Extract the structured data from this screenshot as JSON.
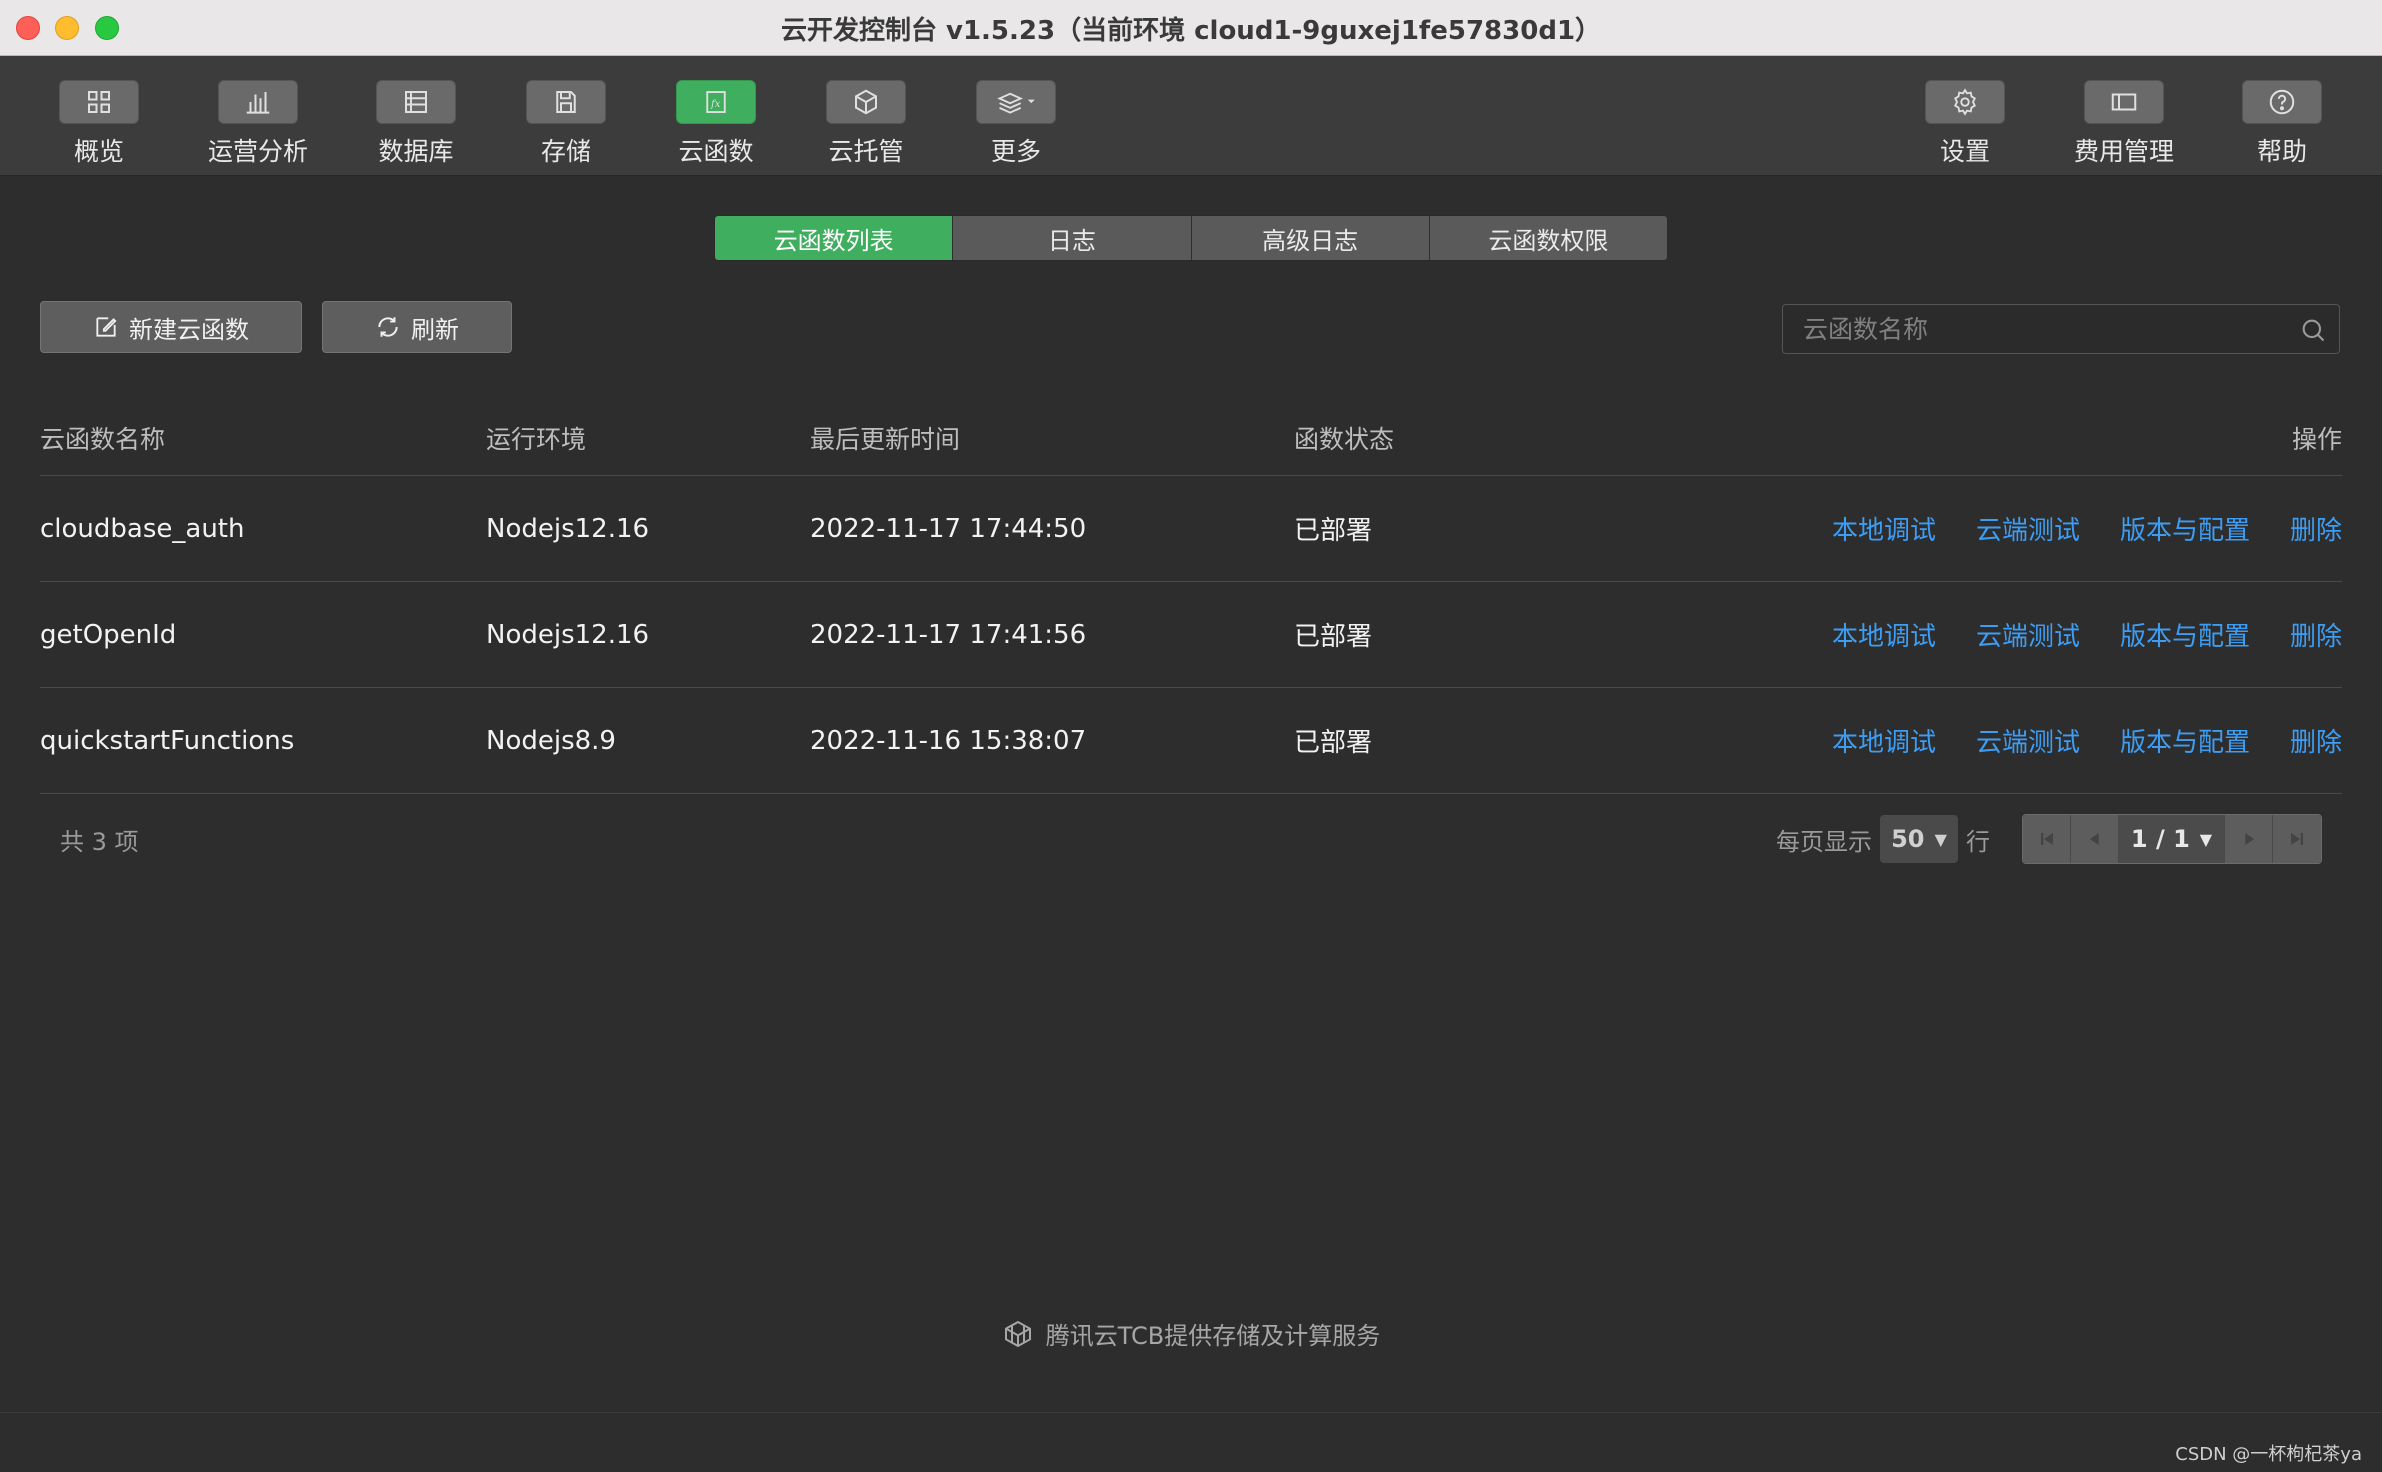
{
  "window": {
    "title": "云开发控制台 v1.5.23（当前环境 cloud1-9guxej1fe57830d1）"
  },
  "toolbar": {
    "left": [
      {
        "label": "概览",
        "icon": "grid-icon"
      },
      {
        "label": "运营分析",
        "icon": "bar-chart-icon"
      },
      {
        "label": "数据库",
        "icon": "database-icon"
      },
      {
        "label": "存储",
        "icon": "save-icon"
      },
      {
        "label": "云函数",
        "icon": "function-icon",
        "active": true
      },
      {
        "label": "云托管",
        "icon": "cube-icon"
      },
      {
        "label": "更多",
        "icon": "layers-icon"
      }
    ],
    "right": [
      {
        "label": "设置",
        "icon": "gear-icon"
      },
      {
        "label": "费用管理",
        "icon": "billing-icon"
      },
      {
        "label": "帮助",
        "icon": "help-icon"
      }
    ]
  },
  "tabs": [
    "云函数列表",
    "日志",
    "高级日志",
    "云函数权限"
  ],
  "actions": {
    "new_label": "新建云函数",
    "refresh_label": "刷新"
  },
  "search": {
    "placeholder": "云函数名称"
  },
  "table": {
    "headers": {
      "name": "云函数名称",
      "env": "运行环境",
      "time": "最后更新时间",
      "status": "函数状态",
      "ops": "操作"
    },
    "rows": [
      {
        "name": "cloudbase_auth",
        "env": "Nodejs12.16",
        "time": "2022-11-17 17:44:50",
        "status": "已部署"
      },
      {
        "name": "getOpenId",
        "env": "Nodejs12.16",
        "time": "2022-11-17 17:41:56",
        "status": "已部署"
      },
      {
        "name": "quickstartFunctions",
        "env": "Nodejs8.9",
        "time": "2022-11-16 15:38:07",
        "status": "已部署"
      }
    ],
    "ops": {
      "local_debug": "本地调试",
      "cloud_test": "云端测试",
      "version_config": "版本与配置",
      "delete": "删除"
    }
  },
  "footer": {
    "total": "共 3 项",
    "per_page_prefix": "每页显示",
    "per_page_value": "50",
    "per_page_suffix": "行",
    "page": "1 / 1"
  },
  "brand": {
    "text": "腾讯云TCB提供存储及计算服务"
  },
  "watermark": "CSDN @一杯枸杞茶ya",
  "colors": {
    "accent_green": "#3fae5e",
    "link_blue": "#3d9df3",
    "background": "#2d2d2d"
  }
}
